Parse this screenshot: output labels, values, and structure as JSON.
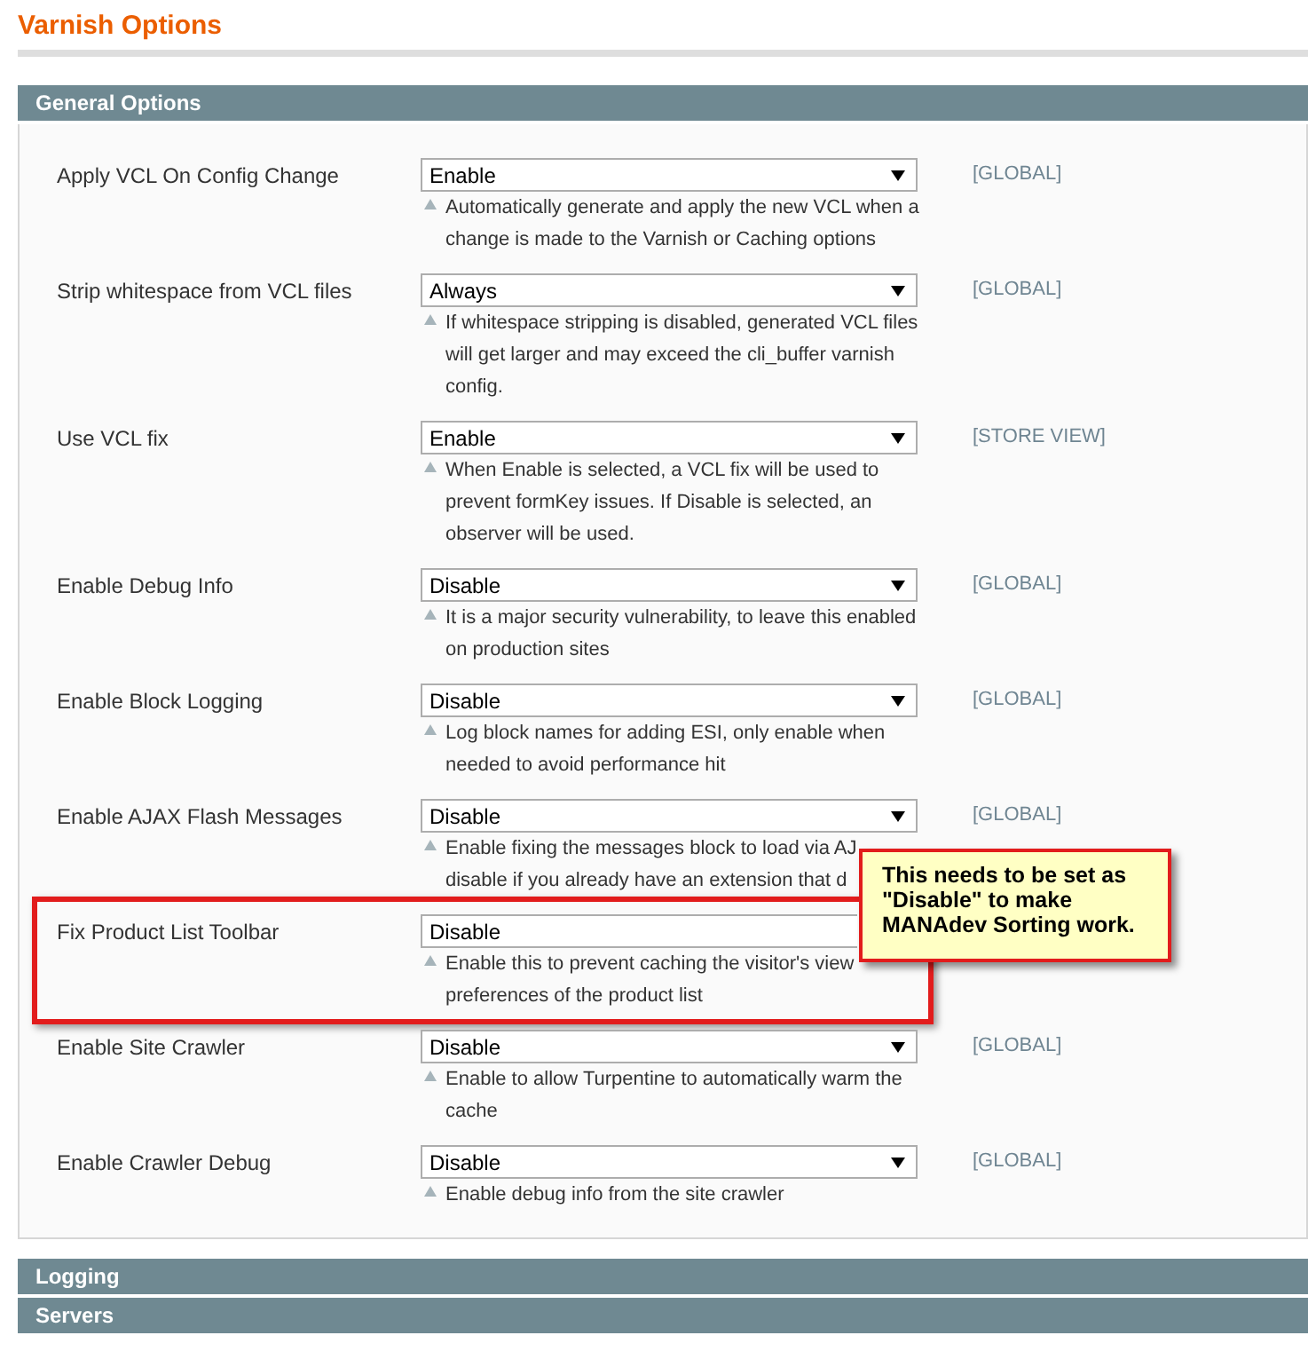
{
  "page_title": "Varnish Options",
  "sections": [
    {
      "title": "General Options",
      "rows": [
        {
          "label": "Apply VCL On Config Change",
          "value": "Enable",
          "scope": "[GLOBAL]",
          "hint": [
            "Automatically generate and apply the new VCL when a",
            "change is made to the Varnish or Caching options"
          ]
        },
        {
          "label": "Strip whitespace from VCL files",
          "value": "Always",
          "scope": "[GLOBAL]",
          "hint": [
            "If whitespace stripping is disabled, generated VCL files",
            "will get larger and may exceed the cli_buffer varnish",
            "config."
          ]
        },
        {
          "label": "Use VCL fix",
          "value": "Enable",
          "scope": "[STORE VIEW]",
          "hint": [
            "When Enable is selected, a VCL fix will be used to",
            "prevent formKey issues. If Disable is selected, an",
            "observer will be used."
          ]
        },
        {
          "label": "Enable Debug Info",
          "value": "Disable",
          "scope": "[GLOBAL]",
          "hint": [
            "It is a major security vulnerability, to leave this enabled",
            "on production sites"
          ]
        },
        {
          "label": "Enable Block Logging",
          "value": "Disable",
          "scope": "[GLOBAL]",
          "hint": [
            "Log block names for adding ESI, only enable when",
            "needed to avoid performance hit"
          ]
        },
        {
          "label": "Enable AJAX Flash Messages",
          "value": "Disable",
          "scope": "[GLOBAL]",
          "hint": [
            "Enable fixing the messages block to load via AJ",
            "disable if you already have an extension that d"
          ]
        },
        {
          "label": "Fix Product List Toolbar",
          "value": "Disable",
          "highlighted": true,
          "hint": [
            "Enable this to prevent caching the visitor's view",
            "preferences of the product list"
          ]
        },
        {
          "label": "Enable Site Crawler",
          "value": "Disable",
          "scope": "[GLOBAL]",
          "hint": [
            "Enable to allow Turpentine to automatically warm the",
            "cache"
          ]
        },
        {
          "label": "Enable Crawler Debug",
          "value": "Disable",
          "scope": "[GLOBAL]",
          "hint": [
            "Enable debug info from the site crawler"
          ]
        }
      ]
    },
    {
      "title": "Logging"
    },
    {
      "title": "Servers"
    }
  ],
  "callout": [
    "This needs to be set as",
    "\"Disable\" to make",
    "MANAdev Sorting work."
  ]
}
